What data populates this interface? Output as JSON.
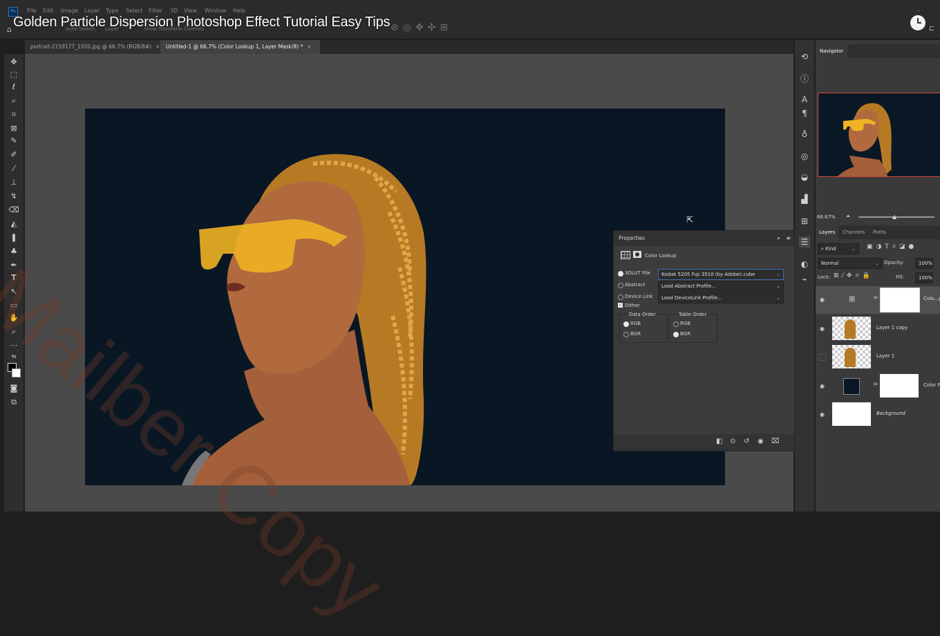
{
  "menu": [
    "File",
    "Edit",
    "Image",
    "Layer",
    "Type",
    "Select",
    "Filter",
    "3D",
    "View",
    "Window",
    "Help"
  ],
  "video_title": "Golden Particle Dispersion Photoshop Effect Tutorial Easy Tips",
  "options_bar": {
    "auto_select": "Auto-Select:",
    "layer_select": "Layer",
    "show_transform": "Show Transform Controls"
  },
  "tabs": [
    {
      "label": "portrait-2159177_1920.jpg @ 66.7% (RGB/8#)",
      "close": "×",
      "active": false
    },
    {
      "label": "Untitled-1 @ 66.7% (Color Lookup 1, Layer Mask/8) *",
      "close": "×",
      "active": true
    }
  ],
  "watermark": "Mailber Copy",
  "properties": {
    "title": "Properties",
    "adjustment": "Color Lookup",
    "lut_label": "3DLUT File",
    "lut_value": "Kodak 5205 Fuji 3510 (by Adobe).cube",
    "abstract_label": "Abstract",
    "abstract_value": "Load Abstract Profile...",
    "devicelink_label": "Device Link",
    "devicelink_value": "Load DeviceLink Profile...",
    "dither": "Dither",
    "data_order": "Data Order",
    "table_order": "Table Order",
    "rgb": "RGB",
    "bgr": "BGR"
  },
  "navigator": {
    "title": "Navigator",
    "zoom": "66.67%"
  },
  "layers_panel": {
    "tabs": [
      "Layers",
      "Channels",
      "Paths"
    ],
    "kind": "Kind",
    "blend_mode": "Normal",
    "opacity_label": "Opacity:",
    "opacity_value": "100%",
    "lock_label": "Lock:",
    "fill_label": "Fill:",
    "fill_value": "100%",
    "layers": [
      {
        "name": "Colo...p",
        "visible": true
      },
      {
        "name": "Layer 1 copy",
        "visible": true
      },
      {
        "name": "Layer 1",
        "visible": false
      },
      {
        "name": "Color Fi",
        "visible": true
      },
      {
        "name": "Background",
        "visible": true
      }
    ]
  },
  "colors": {
    "canvas_bg": "#091724",
    "nav_border": "#d94b3a",
    "hair": "#c98a2a",
    "glasses": "#f0b323",
    "skin": "#b06a3e"
  }
}
